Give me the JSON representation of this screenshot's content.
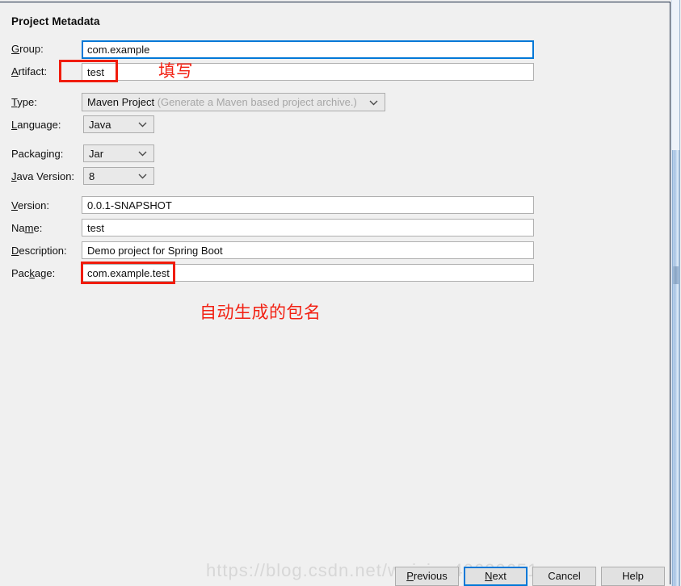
{
  "dialog": {
    "section_title": "Project Metadata"
  },
  "fields": {
    "group": {
      "label_pre": "",
      "label_mnemonic": "G",
      "label_post": "roup:",
      "value": "com.example"
    },
    "artifact": {
      "label_pre": "",
      "label_mnemonic": "A",
      "label_post": "rtifact:",
      "value": "test"
    },
    "type": {
      "label_pre": "",
      "label_mnemonic": "T",
      "label_post": "ype:",
      "value": "Maven Project",
      "hint": "(Generate a Maven based project archive.)"
    },
    "language": {
      "label_pre": "",
      "label_mnemonic": "L",
      "label_post": "anguage:",
      "value": "Java"
    },
    "packaging": {
      "label_pre": "Packa",
      "label_mnemonic": "g",
      "label_post": "ing:",
      "value": "Jar"
    },
    "java_version": {
      "label_pre": "",
      "label_mnemonic": "J",
      "label_post": "ava Version:",
      "value": "8"
    },
    "version": {
      "label_pre": "",
      "label_mnemonic": "V",
      "label_post": "ersion:",
      "value": "0.0.1-SNAPSHOT"
    },
    "name": {
      "label_pre": "Na",
      "label_mnemonic": "m",
      "label_post": "e:",
      "value": "test"
    },
    "description": {
      "label_pre": "",
      "label_mnemonic": "D",
      "label_post": "escription:",
      "value": "Demo project for Spring Boot"
    },
    "package": {
      "label_pre": "Pac",
      "label_mnemonic": "k",
      "label_post": "age:",
      "value": "com.example.test"
    }
  },
  "annotations": {
    "artifact_note": "填写",
    "package_note": "自动生成的包名"
  },
  "footer": {
    "previous": {
      "pre": "",
      "mnemonic": "P",
      "post": "revious"
    },
    "next": {
      "pre": "",
      "mnemonic": "N",
      "post": "ext"
    },
    "cancel": {
      "pre": "Cancel",
      "mnemonic": "",
      "post": ""
    },
    "help": {
      "pre": "Help",
      "mnemonic": "",
      "post": ""
    }
  },
  "watermark": {
    "text": "https://blog.csdn.net/weixin_40620651"
  },
  "colors": {
    "accent": "#0078d7",
    "annotation": "#f01c0c",
    "dialog_bg": "#f0f0f0",
    "field_bg": "#ffffff",
    "combo_bg": "#e9e9e9"
  }
}
